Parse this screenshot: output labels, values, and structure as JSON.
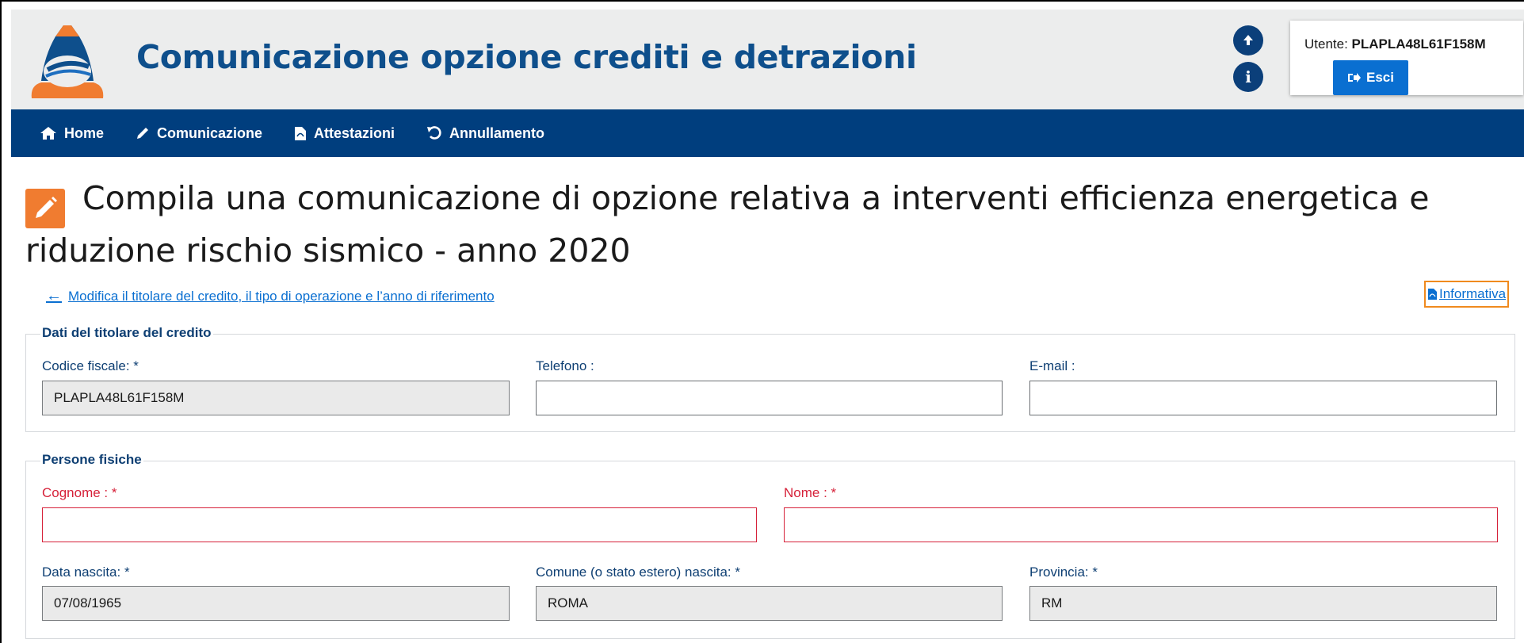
{
  "app": {
    "title": "Comunicazione opzione crediti e detrazioni"
  },
  "user": {
    "label": "Utente:",
    "code": "PLAPLA48L61F158M",
    "logout_label": "Esci"
  },
  "nav": {
    "items": [
      {
        "label": "Home",
        "icon": "home-icon"
      },
      {
        "label": "Comunicazione",
        "icon": "pencil-icon"
      },
      {
        "label": "Attestazioni",
        "icon": "pdf-file-icon"
      },
      {
        "label": "Annullamento",
        "icon": "undo-icon"
      }
    ]
  },
  "page": {
    "title": "Compila una comunicazione di opzione relativa a interventi efficienza energetica e riduzione rischio sismico - anno 2020",
    "back_link": "Modifica il titolare del credito, il tipo di operazione e l’anno di riferimento",
    "info_link": "Informativa"
  },
  "titolare": {
    "legend": "Dati del titolare del credito",
    "codice_fiscale_label": "Codice fiscale: *",
    "codice_fiscale_value": "PLAPLA48L61F158M",
    "telefono_label": "Telefono :",
    "telefono_value": "",
    "email_label": "E-mail :",
    "email_value": ""
  },
  "persone": {
    "legend": "Persone fisiche",
    "cognome_label": "Cognome : *",
    "cognome_value": "",
    "nome_label": "Nome : *",
    "nome_value": "",
    "data_nascita_label": "Data nascita: *",
    "data_nascita_value": "07/08/1965",
    "comune_label": "Comune (o stato estero) nascita: *",
    "comune_value": "ROMA",
    "provincia_label": "Provincia: *",
    "provincia_value": "RM"
  },
  "colors": {
    "header_bg": "#eceded",
    "nav_bg": "#003e7e",
    "title_blue": "#0e4f8c",
    "accent_orange": "#f07c30",
    "button_blue": "#0a6fd1",
    "error_red": "#d62139"
  }
}
